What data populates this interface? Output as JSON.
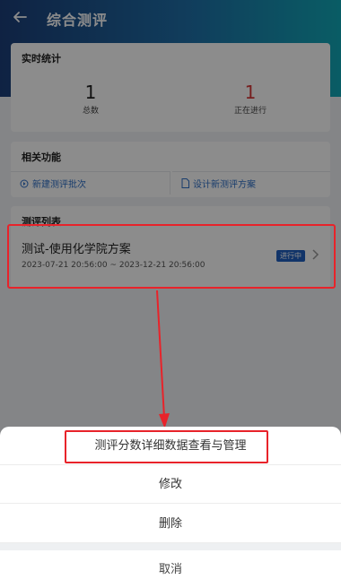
{
  "header": {
    "title": "综合测评"
  },
  "stats": {
    "title": "实时统计",
    "total": {
      "value": "1",
      "label": "总数"
    },
    "running": {
      "value": "1",
      "label": "正在进行"
    }
  },
  "functions": {
    "title": "相关功能",
    "new_batch": "新建测评批次",
    "design_plan": "设计新测评方案"
  },
  "list": {
    "title": "测评列表",
    "items": [
      {
        "name": "测试-使用化学院方案",
        "date_range": "2023-07-21 20:56:00 ~ 2023-12-21 20:56:00",
        "status": "进行中"
      }
    ]
  },
  "action_sheet": {
    "items": [
      "测评分数详细数据查看与管理",
      "修改",
      "删除"
    ],
    "cancel": "取消"
  },
  "colors": {
    "accent": "#2e6fc7",
    "badge": "#1f5fc0",
    "annotation": "#e8232a",
    "running_count": "#d83a3a"
  }
}
